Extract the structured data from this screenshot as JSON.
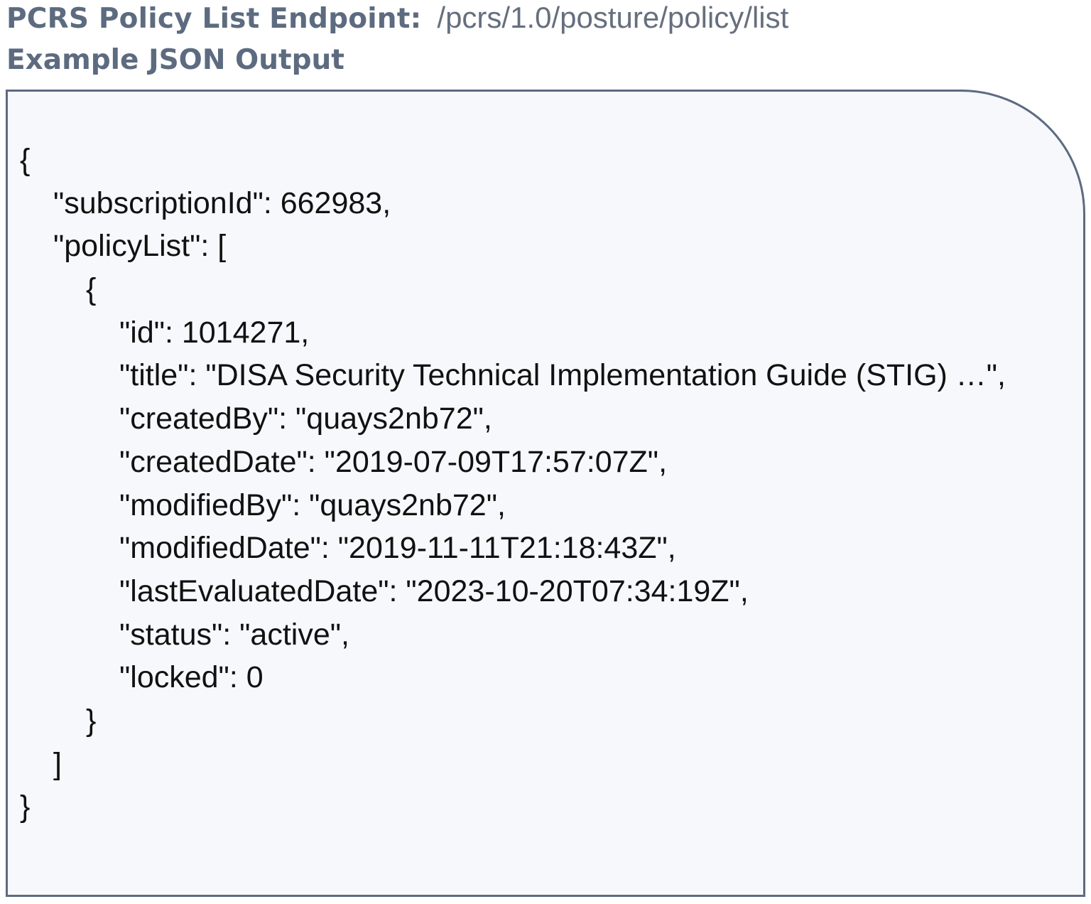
{
  "header": {
    "endpoint_label": "PCRS Policy List Endpoint:",
    "endpoint_path": "/pcrs/1.0/posture/policy/list",
    "output_heading": "Example JSON Output"
  },
  "json_output": {
    "lines": [
      {
        "text": "{",
        "indent": 0
      },
      {
        "text": "\"subscriptionId\": 662983,",
        "indent": 1
      },
      {
        "text": "\"policyList\": [",
        "indent": 1
      },
      {
        "text": "{",
        "indent": 2
      },
      {
        "text": "\"id\": 1014271,",
        "indent": 3
      },
      {
        "text": "\"title\": \"DISA Security Technical Implementation Guide (STIG) …\",",
        "indent": 3
      },
      {
        "text": "\"createdBy\": \"quays2nb72\",",
        "indent": 3
      },
      {
        "text": "\"createdDate\": \"2019-07-09T17:57:07Z\",",
        "indent": 3
      },
      {
        "text": "\"modifiedBy\": \"quays2nb72\",",
        "indent": 3
      },
      {
        "text": "\"modifiedDate\": \"2019-11-11T21:18:43Z\",",
        "indent": 3
      },
      {
        "text": "\"lastEvaluatedDate\": \"2023-10-20T07:34:19Z\",",
        "indent": 3
      },
      {
        "text": "\"status\": \"active\",",
        "indent": 3
      },
      {
        "text": "\"locked\": 0",
        "indent": 3
      },
      {
        "text": "}",
        "indent": 2
      },
      {
        "text": "]",
        "indent": 1
      },
      {
        "text": "}",
        "indent": 0
      }
    ]
  },
  "colors": {
    "heading": "#5d6b80",
    "path": "#666f7e",
    "panel_border": "#5d6b80",
    "panel_background": "#f6f8fb",
    "code_text": "#111111"
  }
}
